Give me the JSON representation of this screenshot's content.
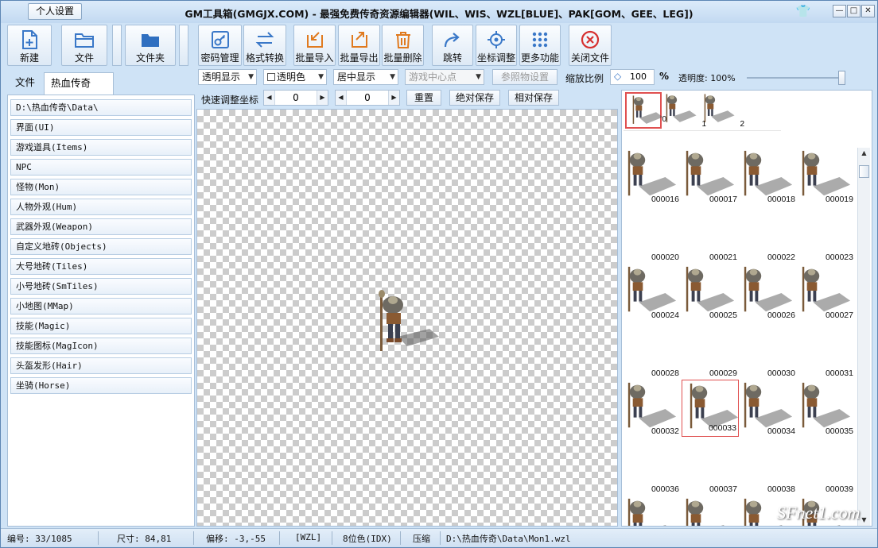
{
  "titlebar": {
    "title": "GM工具箱(GMGJX.COM) - 最强免费传奇资源编辑器(WIL、WIS、WZL[BLUE]、PAK[GOM、GEE、LEG])",
    "personal_settings": "个人设置",
    "min_label": "—",
    "max_label": "□",
    "close_label": "✕"
  },
  "toolbar": {
    "new": "新建",
    "file": "文件",
    "folder": "文件夹",
    "password": "密码管理",
    "convert": "格式转换",
    "batch_import": "批量导入",
    "batch_export": "批量导出",
    "batch_delete": "批量删除",
    "jump": "跳转",
    "coord_adjust": "坐标调整",
    "more": "更多功能",
    "close_file": "关闭文件"
  },
  "left_tabs": {
    "file_tab": "文件",
    "game_tab": "热血传奇",
    "close_glyph": "✕"
  },
  "left_items": [
    "D:\\热血传奇\\Data\\",
    "界面(UI)",
    "游戏道具(Items)",
    "NPC",
    "怪物(Mon)",
    "人物外观(Hum)",
    "武器外观(Weapon)",
    "自定义地砖(Objects)",
    "大号地砖(Tiles)",
    "小号地砖(SmTiles)",
    "小地图(MMap)",
    "技能(Magic)",
    "技能图标(MagIcon)",
    "头盔发形(Hair)",
    "坐骑(Horse)"
  ],
  "options": {
    "display_mode": "透明显示",
    "transparent_color": "透明色",
    "center_mode": "居中显示",
    "game_center": "游戏中心点",
    "ref_settings": "参照物设置",
    "zoom_label": "缩放比例",
    "zoom_value": "100",
    "zoom_unit": "%",
    "opacity": "透明度: 100%",
    "opacity_fraction": 1.0
  },
  "adjust": {
    "label": "快速调整坐标",
    "x": "0",
    "y": "0",
    "reset": "重置",
    "abs_save": "绝对保存",
    "rel_save": "相对保存"
  },
  "strip": [
    {
      "n": "0"
    },
    {
      "n": "1"
    },
    {
      "n": "2"
    }
  ],
  "grid_rows": [
    [
      {
        "id": "000016",
        "sprite": true
      },
      {
        "id": "000017",
        "sprite": true
      },
      {
        "id": "000018",
        "sprite": true
      },
      {
        "id": "000019",
        "sprite": true
      }
    ],
    [
      {
        "id": "000020",
        "sprite": false
      },
      {
        "id": "000021",
        "sprite": false
      },
      {
        "id": "000022",
        "sprite": false
      },
      {
        "id": "000023",
        "sprite": false
      }
    ],
    [
      {
        "id": "000024",
        "sprite": true
      },
      {
        "id": "000025",
        "sprite": true
      },
      {
        "id": "000026",
        "sprite": true
      },
      {
        "id": "000027",
        "sprite": true
      }
    ],
    [
      {
        "id": "000028",
        "sprite": false
      },
      {
        "id": "000029",
        "sprite": false
      },
      {
        "id": "000030",
        "sprite": false
      },
      {
        "id": "000031",
        "sprite": false
      }
    ],
    [
      {
        "id": "000032",
        "sprite": true
      },
      {
        "id": "000033",
        "sprite": true,
        "selected": true
      },
      {
        "id": "000034",
        "sprite": true
      },
      {
        "id": "000035",
        "sprite": true
      }
    ],
    [
      {
        "id": "000036",
        "sprite": false
      },
      {
        "id": "000037",
        "sprite": false
      },
      {
        "id": "000038",
        "sprite": false
      },
      {
        "id": "000039",
        "sprite": false
      }
    ],
    [
      {
        "id": "",
        "sprite": true
      },
      {
        "id": "",
        "sprite": true
      },
      {
        "id": "",
        "sprite": true
      },
      {
        "id": "",
        "sprite": true
      }
    ]
  ],
  "status": {
    "index": "编号: 33/1085",
    "size": "尺寸: 84,81",
    "offset": "偏移: -3,-55",
    "format": "[WZL]",
    "color": "8位色(IDX)",
    "compress": "压缩",
    "path": "D:\\热血传奇\\Data\\Mon1.wzl"
  },
  "watermark": "SFnet1.com",
  "colors": {
    "accent": "#3a78c8",
    "window_bg": "#cfe3f6",
    "selection": "#e05050",
    "close_red": "#d63030"
  }
}
